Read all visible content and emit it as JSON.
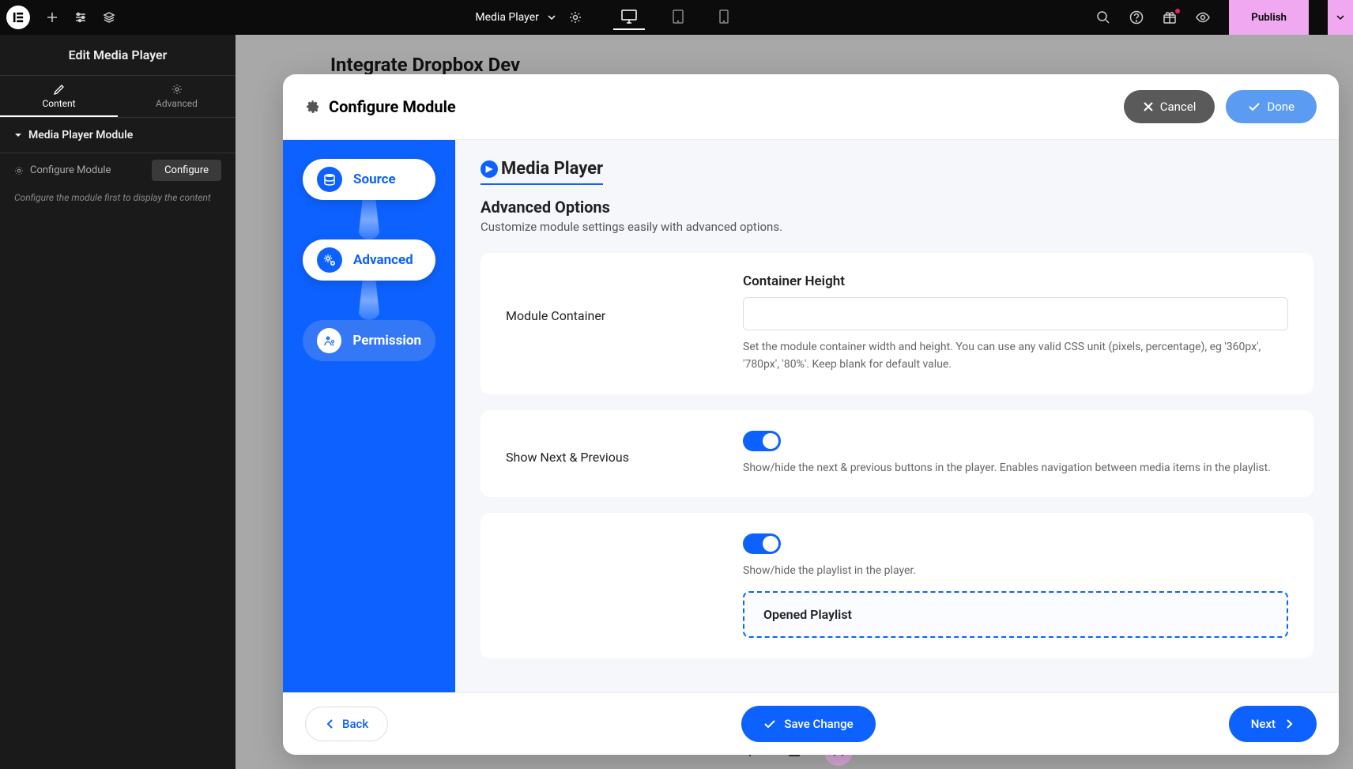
{
  "topbar": {
    "page_name": "Media Player",
    "publish_label": "Publish"
  },
  "sidebar": {
    "title": "Edit Media Player",
    "tabs": {
      "content": "Content",
      "advanced": "Advanced"
    },
    "module_section": "Media Player Module",
    "config_label": "Configure Module",
    "configure_btn": "Configure",
    "hint": "Configure the module first to display the content"
  },
  "page_heading": "Integrate Dropbox Dev",
  "modal": {
    "title": "Configure Module",
    "cancel": "Cancel",
    "done": "Done",
    "back": "Back",
    "save": "Save Change",
    "next": "Next"
  },
  "wizard": {
    "steps": {
      "source": "Source",
      "advanced": "Advanced",
      "permission": "Permission"
    },
    "title": "Media Player",
    "subtitle": "Advanced Options",
    "desc": "Customize module settings easily with advanced options.",
    "container": {
      "label": "Module Container",
      "heading": "Container Height",
      "help": "Set the module container width and height. You can use any valid CSS unit (pixels, percentage), eg '360px', '780px', '80%'. Keep blank for default value."
    },
    "nextprev": {
      "label": "Show Next & Previous",
      "help": "Show/hide the next & previous buttons in the player. Enables navigation between media items in the playlist."
    },
    "playlist": {
      "help": "Show/hide the playlist in the player.",
      "opened": "Opened Playlist"
    }
  }
}
